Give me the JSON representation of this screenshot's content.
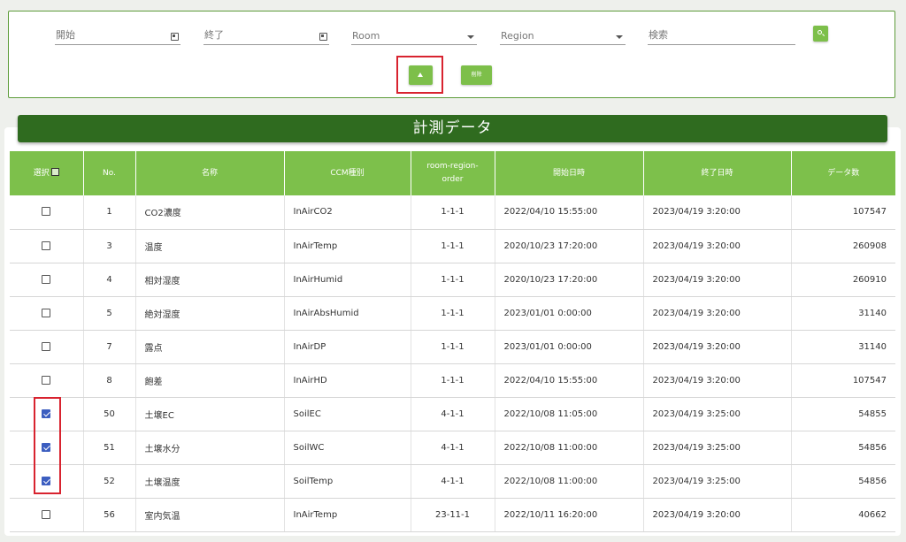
{
  "filters": {
    "start_label": "開始",
    "end_label": "終了",
    "room_label": "Room",
    "region_label": "Region",
    "search_label": "検索",
    "delete_button_label": "削除"
  },
  "icons": {
    "calendar": "calendar-icon",
    "dropdown": "chevron-down-icon",
    "search": "search-icon",
    "upload": "upload-icon"
  },
  "colors": {
    "accent": "#7dc04b",
    "title_bar": "#2f6b1f",
    "highlight": "#d8232f",
    "checkbox_checked": "#3c5ec0"
  },
  "panel": {
    "title": "計測データ"
  },
  "table": {
    "headers": {
      "select": "選択",
      "no": "No.",
      "name": "名称",
      "ccm_type": "CCM種別",
      "rro": "room-region-order",
      "start": "開始日時",
      "end": "終了日時",
      "count": "データ数"
    },
    "rows": [
      {
        "checked": false,
        "no": "1",
        "name": "CO2濃度",
        "ccm": "InAirCO2",
        "rro": "1-1-1",
        "start": "2022/04/10 15:55:00",
        "end": "2023/04/19 3:20:00",
        "count": "107547"
      },
      {
        "checked": false,
        "no": "3",
        "name": "温度",
        "ccm": "InAirTemp",
        "rro": "1-1-1",
        "start": "2020/10/23 17:20:00",
        "end": "2023/04/19 3:20:00",
        "count": "260908"
      },
      {
        "checked": false,
        "no": "4",
        "name": "相対湿度",
        "ccm": "InAirHumid",
        "rro": "1-1-1",
        "start": "2020/10/23 17:20:00",
        "end": "2023/04/19 3:20:00",
        "count": "260910"
      },
      {
        "checked": false,
        "no": "5",
        "name": "絶対湿度",
        "ccm": "InAirAbsHumid",
        "rro": "1-1-1",
        "start": "2023/01/01 0:00:00",
        "end": "2023/04/19 3:20:00",
        "count": "31140"
      },
      {
        "checked": false,
        "no": "7",
        "name": "露点",
        "ccm": "InAirDP",
        "rro": "1-1-1",
        "start": "2023/01/01 0:00:00",
        "end": "2023/04/19 3:20:00",
        "count": "31140"
      },
      {
        "checked": false,
        "no": "8",
        "name": "飽差",
        "ccm": "InAirHD",
        "rro": "1-1-1",
        "start": "2022/04/10 15:55:00",
        "end": "2023/04/19 3:20:00",
        "count": "107547"
      },
      {
        "checked": true,
        "no": "50",
        "name": "土壌EC",
        "ccm": "SoilEC",
        "rro": "4-1-1",
        "start": "2022/10/08 11:05:00",
        "end": "2023/04/19 3:25:00",
        "count": "54855"
      },
      {
        "checked": true,
        "no": "51",
        "name": "土壌水分",
        "ccm": "SoilWC",
        "rro": "4-1-1",
        "start": "2022/10/08 11:00:00",
        "end": "2023/04/19 3:25:00",
        "count": "54856"
      },
      {
        "checked": true,
        "no": "52",
        "name": "土壌温度",
        "ccm": "SoilTemp",
        "rro": "4-1-1",
        "start": "2022/10/08 11:00:00",
        "end": "2023/04/19 3:25:00",
        "count": "54856"
      },
      {
        "checked": false,
        "no": "56",
        "name": "室内気温",
        "ccm": "InAirTemp",
        "rro": "23-11-1",
        "start": "2022/10/11 16:20:00",
        "end": "2023/04/19 3:20:00",
        "count": "40662"
      }
    ]
  }
}
